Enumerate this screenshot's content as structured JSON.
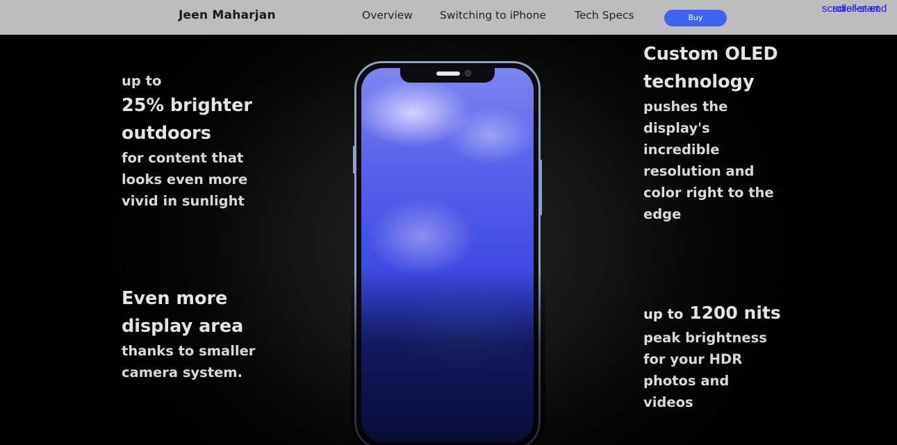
{
  "nav": {
    "brand": "Jeen Maharjan",
    "links": [
      "Overview",
      "Switching to iPhone",
      "Tech Specs"
    ],
    "buy_label": "Buy",
    "scroller_start": "scroller-start",
    "scroller_end": "scroller-end"
  },
  "features": {
    "brighter": {
      "lead": "up to",
      "headline": [
        "25% brighter",
        "outdoors"
      ],
      "body": [
        "for content that",
        "looks even more",
        "vivid in sunlight"
      ]
    },
    "area": {
      "headline": [
        "Even more",
        "display area"
      ],
      "body": [
        "thanks to smaller",
        "camera system."
      ]
    },
    "oled": {
      "headline": [
        "Custom OLED",
        "technology"
      ],
      "body": [
        "pushes the",
        "display's",
        "incredible",
        "resolution and",
        "color right to the",
        "edge"
      ]
    },
    "nits": {
      "lead": "up to",
      "number": "1200 nits",
      "body": [
        "peak brightness",
        "for your HDR",
        "photos and",
        "videos"
      ]
    }
  },
  "colors": {
    "nav_bg": "#bdbdbd",
    "buy_button": "#3d63f0",
    "scroller_text": "#1a1af5",
    "feature_text": "#d9d9d9",
    "phone_frame": "#8fa3bd",
    "screen_blue": "#3b4be0"
  },
  "phone": {
    "image": "iphone-front-blue-wallpaper"
  }
}
